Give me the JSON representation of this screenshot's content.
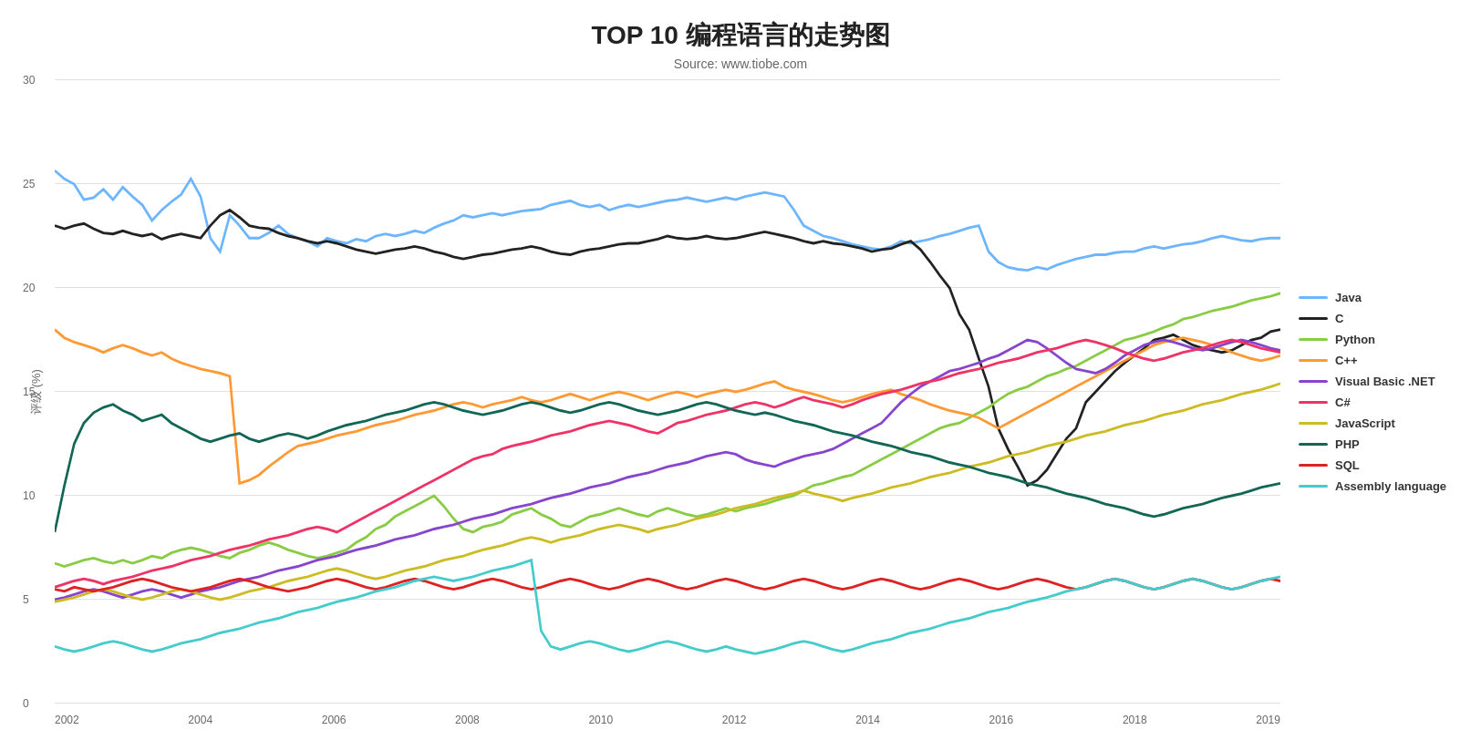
{
  "title": "TOP 10 编程语言的走势图",
  "subtitle": "Source: www.tiobe.com",
  "y_axis_label": "评级 (%)",
  "x_labels": [
    "2002",
    "2004",
    "2006",
    "2008",
    "2010",
    "2012",
    "2014",
    "2016",
    "2018",
    "2019"
  ],
  "y_labels": [
    "0",
    "5",
    "10",
    "15",
    "20",
    "25",
    "30"
  ],
  "legend": [
    {
      "name": "Java",
      "color": "#6db6ff"
    },
    {
      "name": "C",
      "color": "#222222"
    },
    {
      "name": "Python",
      "color": "#88cc44"
    },
    {
      "name": "C++",
      "color": "#ff9933"
    },
    {
      "name": "Visual Basic .NET",
      "color": "#8844cc"
    },
    {
      "name": "C#",
      "color": "#ee3366"
    },
    {
      "name": "JavaScript",
      "color": "#ccbb22"
    },
    {
      "name": "PHP",
      "color": "#116655"
    },
    {
      "name": "SQL",
      "color": "#dd2222"
    },
    {
      "name": "Assembly language",
      "color": "#44cccc"
    }
  ]
}
